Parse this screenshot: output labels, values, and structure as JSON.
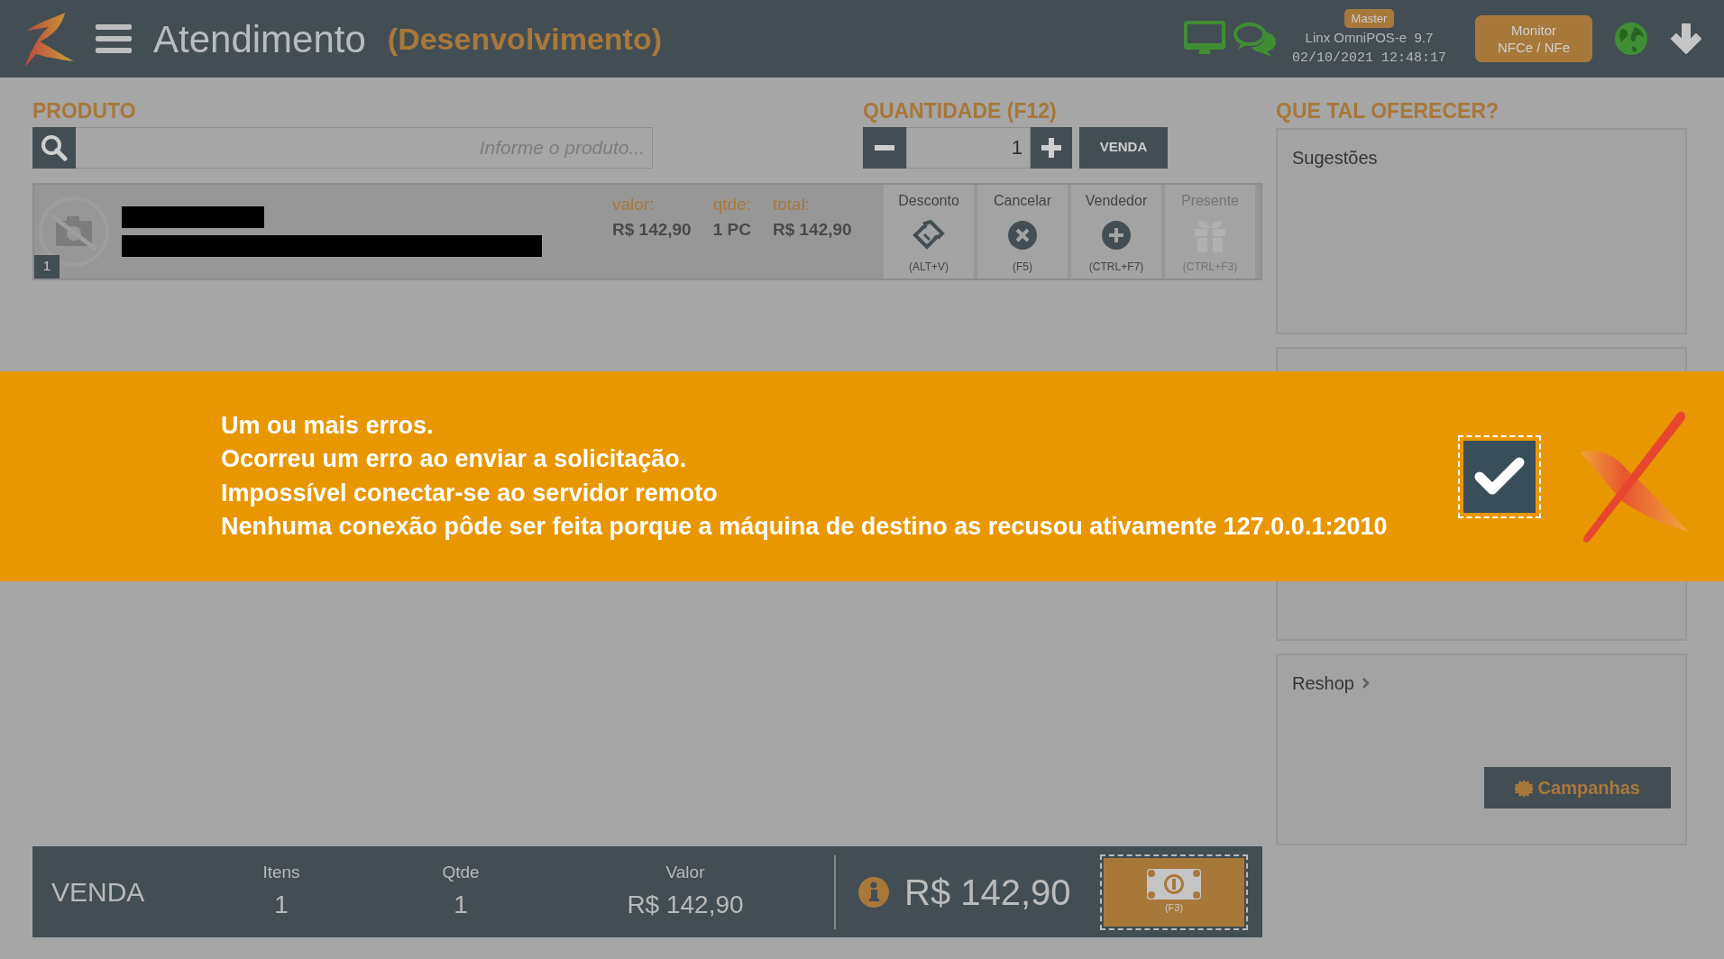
{
  "header": {
    "title": "Atendimento",
    "environment": "(Desenvolvimento)",
    "badge": "Master",
    "app_version": "Linx OmniPOS-e  9.7",
    "datetime": "02/10/2021 12:48:17",
    "monitor_button": [
      "Monitor",
      "NFCe / NFe"
    ]
  },
  "product": {
    "label": "PRODUTO",
    "placeholder": "Informe o produto..."
  },
  "quantity": {
    "label": "QUANTIDADE (F12)",
    "value": "1",
    "sell_button": "VENDA"
  },
  "items": [
    {
      "index": "1",
      "fields": [
        {
          "label": "valor:",
          "value": "R$ 142,90"
        },
        {
          "label": "qtde:",
          "value": "1 PC"
        },
        {
          "label": "total:",
          "value": "R$ 142,90"
        }
      ],
      "actions": [
        {
          "kind": "discount",
          "label": "Desconto",
          "shortcut": "(ALT+V)",
          "disabled": false
        },
        {
          "kind": "cancel",
          "label": "Cancelar",
          "shortcut": "(F5)",
          "disabled": false
        },
        {
          "kind": "seller",
          "label": "Vendedor",
          "shortcut": "(CTRL+F7)",
          "disabled": false
        },
        {
          "kind": "gift",
          "label": "Presente",
          "shortcut": "(CTRL+F3)",
          "disabled": true
        }
      ]
    }
  ],
  "offers": {
    "title": "QUE TAL OFERECER?",
    "suggestions": "Sugestões",
    "reshop": "Reshop",
    "campaigns_button": "Campanhas"
  },
  "footer": {
    "label": "VENDA",
    "stats": [
      {
        "label": "Itens",
        "value": "1"
      },
      {
        "label": "Qtde",
        "value": "1"
      },
      {
        "label": "Valor",
        "value": "R$ 142,90"
      }
    ],
    "total": "R$ 142,90",
    "pay_shortcut": "(F3)"
  },
  "alert": {
    "lines": [
      "Um ou mais erros.",
      "Ocorreu um erro ao enviar a solicitação.",
      "Impossível conectar-se ao servidor remoto",
      "Nenhuma conexão pôde ser feita porque a máquina de destino as recusou ativamente 127.0.0.1:2010"
    ]
  }
}
